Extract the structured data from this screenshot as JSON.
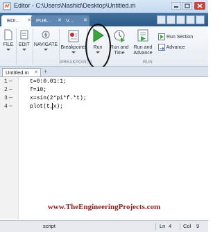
{
  "window": {
    "title": "Editor - C:\\Users\\Nashid\\Desktop\\Untitled.m",
    "icon": "matlab-editor-icon"
  },
  "toolstrip_tabs": [
    {
      "label": "EDI...",
      "active": true
    },
    {
      "label": "PUB...",
      "active": false
    },
    {
      "label": "V...",
      "active": false
    }
  ],
  "ribbon": {
    "file_label": "FILE",
    "edit_label": "EDIT",
    "navigate_label": "NAVIGATE",
    "breakpoints_label": "Breakpoints",
    "breakpoints_group": "BREAKPOINTS",
    "run_label": "Run",
    "run_and_time_label": "Run and Time",
    "run_and_advance_label": "Run and Advance",
    "run_section_label": "Run Section",
    "advance_label": "Advance",
    "run_group": "RUN"
  },
  "document": {
    "tab_label": "Untitled.m",
    "lines": [
      {
        "number": "1",
        "marker": "—",
        "code": "t=0:0.01:1;"
      },
      {
        "number": "2",
        "marker": "—",
        "code": "f=10;"
      },
      {
        "number": "3",
        "marker": "—",
        "code": "x=sin(2*pi*f.*t);"
      },
      {
        "number": "4",
        "marker": "—",
        "code": "plot(t,x);"
      }
    ]
  },
  "watermark": "www.TheEngineeringProjects.com",
  "status": {
    "mode": "script",
    "ln_label": "Ln",
    "ln_value": "4",
    "col_label": "Col",
    "col_value": "9"
  },
  "colors": {
    "tab_strip": "#2d5a86",
    "run_icon": "#3aa53a",
    "watermark": "#8b1d1d"
  }
}
